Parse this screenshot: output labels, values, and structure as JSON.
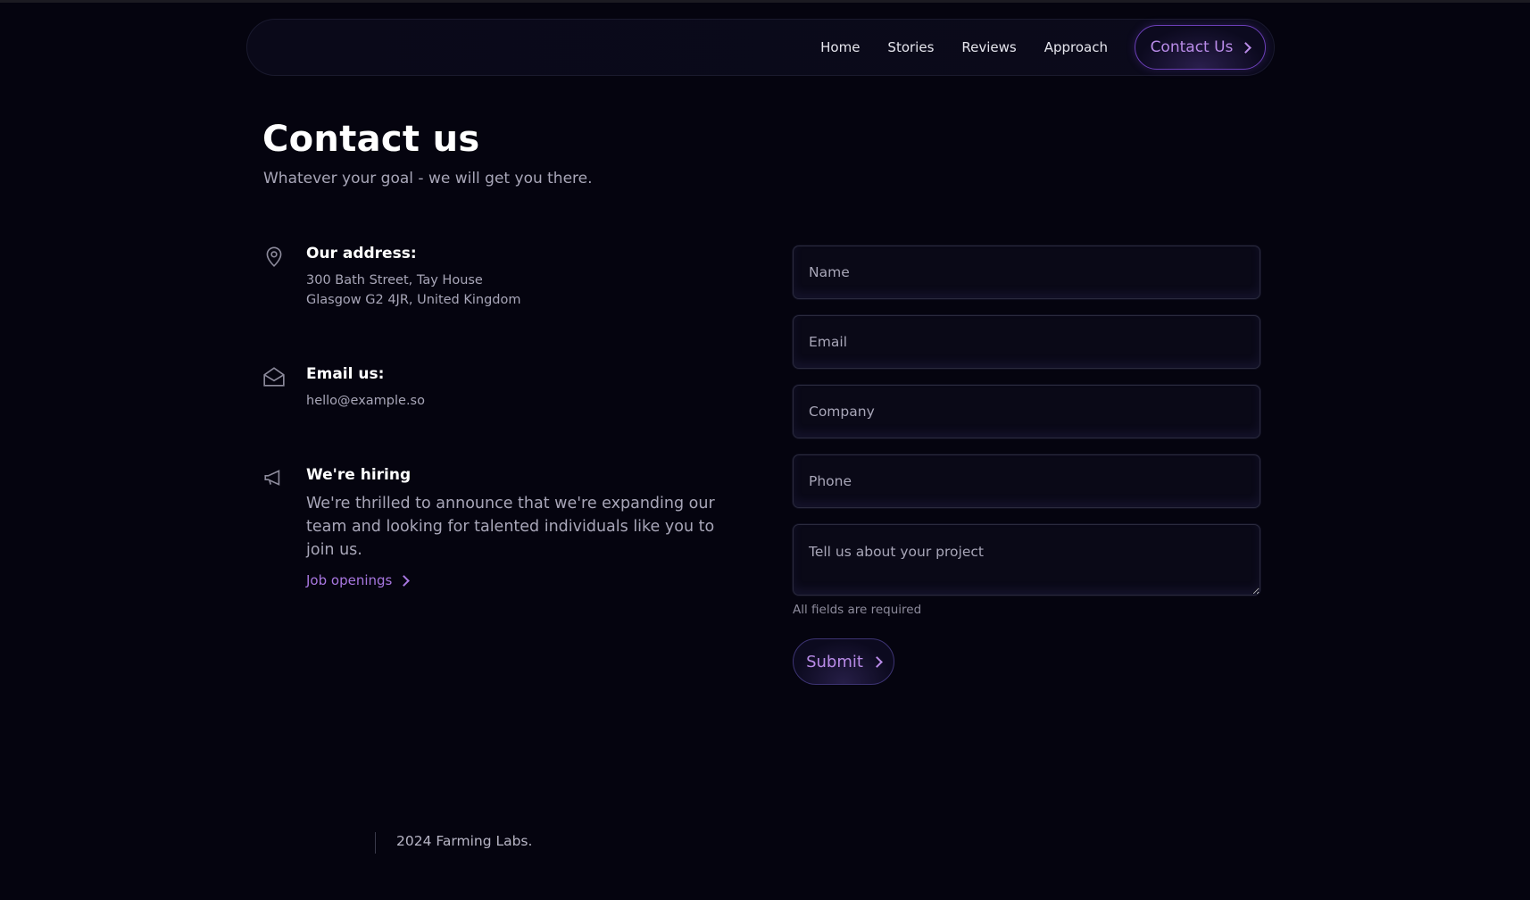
{
  "nav": {
    "links": [
      "Home",
      "Stories",
      "Reviews",
      "Approach"
    ],
    "cta_label": "Contact Us"
  },
  "hero": {
    "title": "Contact us",
    "subtitle": "Whatever your goal - we will get you there."
  },
  "info": {
    "address": {
      "heading": "Our address:",
      "line1": "300 Bath Street, Tay House",
      "line2": "Glasgow G2 4JR, United Kingdom",
      "icon": "map-pin-icon"
    },
    "email": {
      "heading": "Email us:",
      "value": "hello@example.so",
      "icon": "envelope-open-icon"
    },
    "hiring": {
      "heading": "We're hiring",
      "text": "We're thrilled to announce that we're expanding our team and looking for talented individuals like you to join us.",
      "link": "Job openings",
      "icon": "megaphone-icon"
    }
  },
  "form": {
    "name_placeholder": "Name",
    "email_placeholder": "Email",
    "company_placeholder": "Company",
    "phone_placeholder": "Phone",
    "project_placeholder": "Tell us about your project",
    "required_note": "All fields are required",
    "submit_label": "Submit"
  },
  "footer": {
    "copyright": "2024 Farming Labs."
  },
  "colors": {
    "background": "#05040f",
    "accent": "#b98be8",
    "accent_border": "#6c3fb8",
    "muted_text": "#a8a6b8"
  }
}
